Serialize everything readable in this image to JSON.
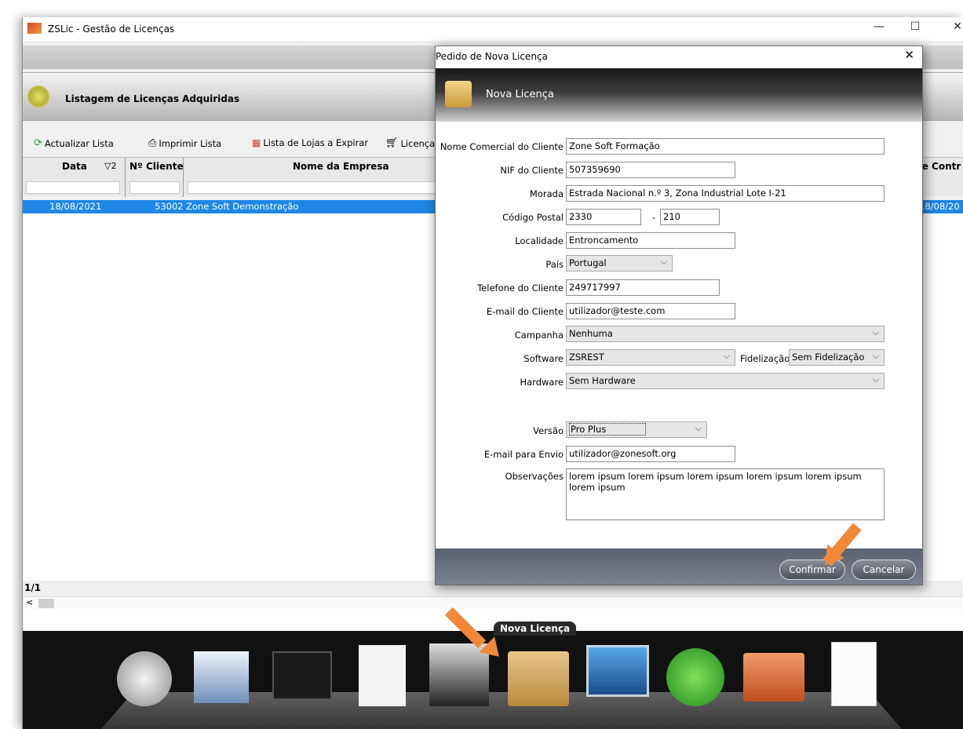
{
  "app": {
    "title": "ZSLic - Gestão de Licenças"
  },
  "header": {
    "title": "Listagem de Licenças Adquiridas"
  },
  "toolbar": {
    "refresh": "Actualizar Lista",
    "print": "Imprimir Lista",
    "expiring": "Lista de Lojas a Expirar",
    "licenses": "Licença"
  },
  "grid": {
    "columns": [
      "Data",
      "Nº Cliente",
      "Nome da Empresa",
      "te Contr"
    ],
    "sort_indicator": "▽2",
    "rows": [
      {
        "date": "18/08/2021",
        "client": "53002",
        "company": "Zone Soft Demonstração",
        "contract": "18/08/20"
      }
    ],
    "pager": "1/1"
  },
  "dock": {
    "tooltip": "Nova Licença"
  },
  "dialog": {
    "title": "Pedido de Nova Licença",
    "banner": "Nova Licença",
    "fields": {
      "commercial_name": {
        "label": "Nome Comercial do Cliente",
        "value": "Zone Soft Formação"
      },
      "nif": {
        "label": "NIF do Cliente",
        "value": "507359690"
      },
      "address": {
        "label": "Morada",
        "value": "Estrada Nacional n.º 3, Zona Industrial Lote I-21"
      },
      "postal": {
        "label": "Código Postal",
        "value": "2330",
        "value2": "210",
        "sep": "-"
      },
      "locality": {
        "label": "Localidade",
        "value": "Entroncamento"
      },
      "country": {
        "label": "País",
        "value": "Portugal"
      },
      "phone": {
        "label": "Telefone do Cliente",
        "value": "249717997"
      },
      "email": {
        "label": "E-mail do Cliente",
        "value": "utilizador@teste.com"
      },
      "campaign": {
        "label": "Campanha",
        "value": "Nenhuma"
      },
      "software": {
        "label": "Software",
        "value": "ZSREST"
      },
      "loyalty": {
        "label": "Fidelização",
        "value": "Sem Fidelização"
      },
      "hardware": {
        "label": "Hardware",
        "value": "Sem Hardware"
      },
      "version": {
        "label": "Versão",
        "value": "Pro Plus"
      },
      "send_email": {
        "label": "E-mail para Envio",
        "value": "utilizador@zonesoft.org"
      },
      "notes": {
        "label": "Observações",
        "value": "lorem ipsum lorem ipsum lorem ipsum lorem ipsum lorem ipsum lorem ipsum"
      }
    },
    "confirm": "Confirmar",
    "cancel": "Cancelar"
  },
  "colors": {
    "accent": "#1e87e5",
    "arrow": "#f0883a"
  },
  "icons": [
    "refresh-icon",
    "print-icon",
    "calendar-icon",
    "cart-icon",
    "lock-icon",
    "license-icon"
  ]
}
